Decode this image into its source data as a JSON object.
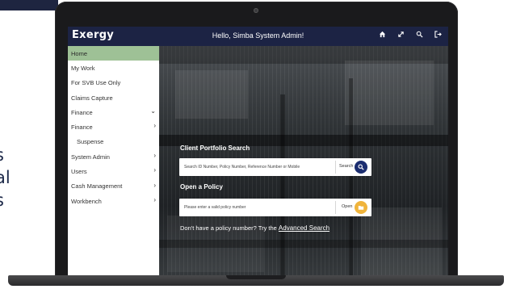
{
  "side_text": [
    "s",
    "al",
    "s"
  ],
  "header": {
    "logo": "Exergy",
    "greeting": "Hello, Simba System Admin!",
    "icons": [
      "home-icon",
      "expand-icon",
      "search-icon",
      "logout-icon"
    ]
  },
  "sidebar": {
    "items": [
      {
        "label": "Home",
        "active": true,
        "chevron": ""
      },
      {
        "label": "My Work",
        "chevron": ""
      },
      {
        "label": "For SVB Use Only",
        "chevron": ""
      },
      {
        "label": "Claims Capture",
        "chevron": ""
      },
      {
        "label": "Finance",
        "chevron": "⌄"
      },
      {
        "label": "Finance",
        "chevron": "›"
      },
      {
        "label": "Suspense",
        "chevron": ""
      },
      {
        "label": "System Admin",
        "chevron": "›"
      },
      {
        "label": "Users",
        "chevron": "›"
      },
      {
        "label": "Cash Management",
        "chevron": "›"
      },
      {
        "label": "Workbench",
        "chevron": "›"
      }
    ]
  },
  "client_search": {
    "title": "Client Portfolio Search",
    "placeholder": "Search ID Number, Policy Number, Reference Number or Mobile",
    "button_label": "Search"
  },
  "open_policy": {
    "title": "Open a Policy",
    "placeholder": "Please enter a valid policy number",
    "button_label": "Open"
  },
  "hint": {
    "text": "Don't have a policy number? Try the",
    "link": "Advanced Search"
  },
  "colors": {
    "header": "#1c2344",
    "active_nav": "#9ec196",
    "search_button": "#1c2e70",
    "open_button": "#f0b43c"
  }
}
